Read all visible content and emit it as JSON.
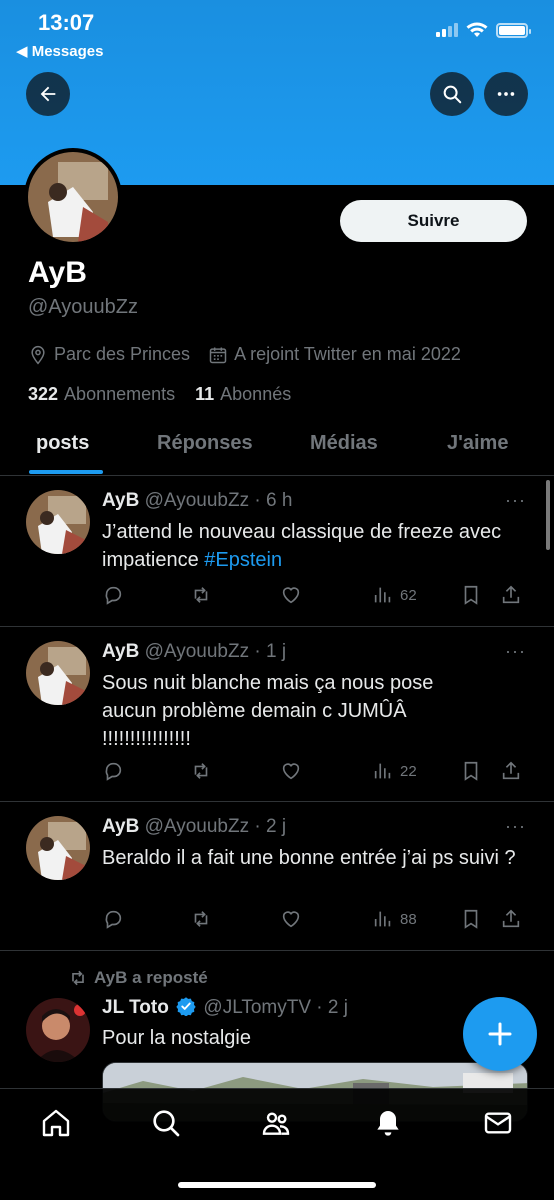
{
  "status_bar": {
    "time": "13:07",
    "back_app": "◀ Messages"
  },
  "profile": {
    "display_name": "AyB",
    "handle": "@AyouubZz",
    "location": "Parc des Princes",
    "joined": "A rejoint Twitter en mai 2022",
    "following_count": "322",
    "following_label": "Abonnements",
    "followers_count": "11",
    "followers_label": "Abonnés",
    "follow_label": "Suivre"
  },
  "tabs": [
    {
      "label": "posts",
      "active": true
    },
    {
      "label": "Réponses",
      "active": false
    },
    {
      "label": "Médias",
      "active": false
    },
    {
      "label": "J'aime",
      "active": false
    }
  ],
  "posts": [
    {
      "name": "AyB",
      "meta": "@AyouubZz · 6 h",
      "text": "J’attend le nouveau classique de freeze avec impatience ",
      "hashtag": "#Epstein",
      "views": "62"
    },
    {
      "name": "AyB",
      "meta": "@AyouubZz · 1 j",
      "text": "Sous nuit blanche mais ça nous pose aucun problème demain c JUMÛÂ !!!!!!!!!!!!!!!!",
      "views": "22"
    },
    {
      "name": "AyB",
      "meta": "@AyouubZz · 2 j",
      "text": "Beraldo il a fait une bonne entrée j’ai ps suivi ?",
      "views": "88"
    }
  ],
  "repost": {
    "label": "AyB a reposté",
    "name": "JL Toto",
    "meta": "@JLTomyTV · 2 j",
    "text": "Pour la nostalgie"
  },
  "more_label": "···",
  "colors": {
    "accent": "#1d9bf0",
    "background": "#000000",
    "muted": "#71767b"
  }
}
